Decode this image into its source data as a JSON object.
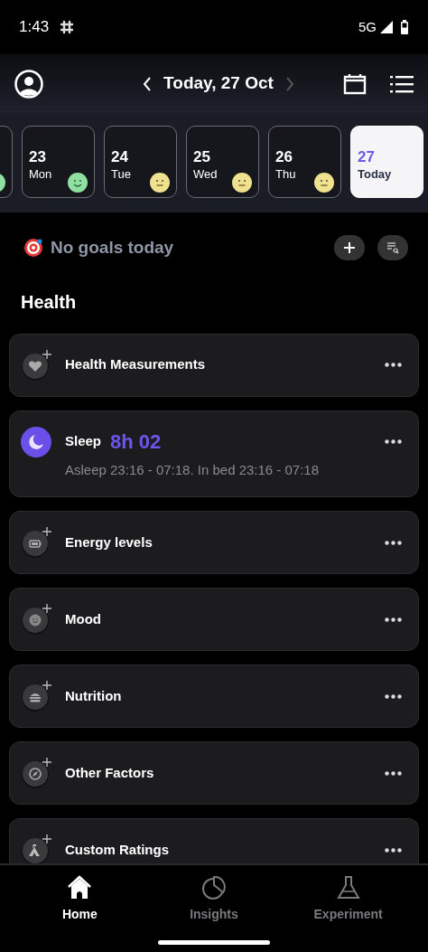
{
  "status_bar": {
    "time": "1:43",
    "network": "5G"
  },
  "header": {
    "date_title": "Today, 27 Oct"
  },
  "days": [
    {
      "color": "#8ee0a0",
      "selected": false
    },
    {
      "number": "23",
      "weekday": "Mon",
      "color": "#8ee0a0",
      "selected": false
    },
    {
      "number": "24",
      "weekday": "Tue",
      "color": "#f0e18e",
      "selected": false
    },
    {
      "number": "25",
      "weekday": "Wed",
      "color": "#f0e18e",
      "selected": false
    },
    {
      "number": "26",
      "weekday": "Thu",
      "color": "#f0e18e",
      "selected": false
    },
    {
      "number": "27",
      "weekday": "Today",
      "selected": true
    }
  ],
  "goals": {
    "text": "No goals today"
  },
  "section_title": "Health",
  "items": [
    {
      "kind": "add",
      "title": "Health Measurements"
    },
    {
      "kind": "sleep",
      "title": "Sleep",
      "value": "8h 02",
      "detail": "Asleep 23:16 - 07:18. In bed 23:16 - 07:18"
    },
    {
      "kind": "add",
      "title": "Energy levels"
    },
    {
      "kind": "add",
      "title": "Mood"
    },
    {
      "kind": "add",
      "title": "Nutrition"
    },
    {
      "kind": "add",
      "title": "Other Factors"
    },
    {
      "kind": "add",
      "title": "Custom Ratings"
    }
  ],
  "nav": [
    {
      "label": "Home",
      "selected": true
    },
    {
      "label": "Insights",
      "selected": false
    },
    {
      "label": "Experiment",
      "selected": false
    }
  ]
}
